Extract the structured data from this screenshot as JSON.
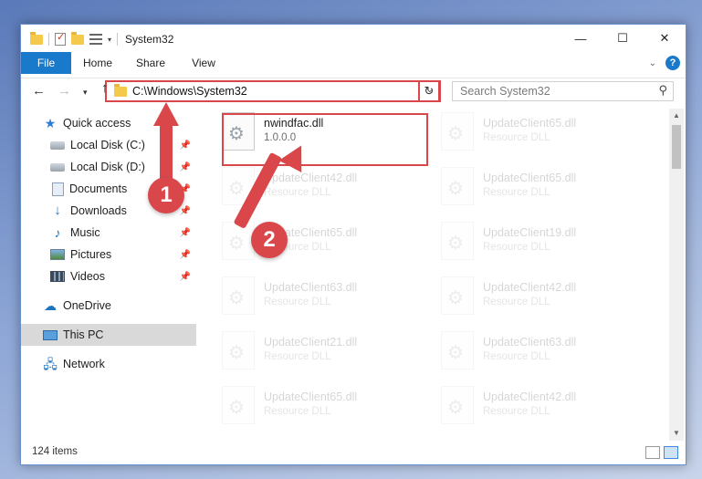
{
  "titlebar": {
    "title": "System32",
    "controls": {
      "minimize": "—",
      "maximize": "☐",
      "close": "✕"
    }
  },
  "ribbon": {
    "tabs": [
      "File",
      "Home",
      "Share",
      "View"
    ],
    "help": "?"
  },
  "address_bar": {
    "path": "C:\\Windows\\System32",
    "refresh_glyph": "↻"
  },
  "search": {
    "placeholder": "Search System32"
  },
  "nav": {
    "quick_access": "Quick access",
    "items": [
      {
        "label": "Local Disk (C:)",
        "icon": "drive-icon",
        "pinned": true
      },
      {
        "label": "Local Disk (D:)",
        "icon": "drive-icon",
        "pinned": true
      },
      {
        "label": "Documents",
        "icon": "documents-icon",
        "pinned": true
      },
      {
        "label": "Downloads",
        "icon": "downloads-icon",
        "pinned": true
      },
      {
        "label": "Music",
        "icon": "music-icon",
        "pinned": true
      },
      {
        "label": "Pictures",
        "icon": "pictures-icon",
        "pinned": true
      },
      {
        "label": "Videos",
        "icon": "videos-icon",
        "pinned": true
      }
    ],
    "onedrive": "OneDrive",
    "this_pc": "This PC",
    "network": "Network"
  },
  "files": [
    {
      "name": "nwindfac.dll",
      "sub": "1.0.0.0",
      "faded": false
    },
    {
      "name": "UpdateClient65.dll",
      "sub": "Resource DLL",
      "faded": true
    },
    {
      "name": "UpdateClient42.dll",
      "sub": "Resource DLL",
      "faded": true
    },
    {
      "name": "UpdateClient65.dll",
      "sub": "Resource DLL",
      "faded": true
    },
    {
      "name": "UpdateClient65.dll",
      "sub": "Resource DLL",
      "faded": true
    },
    {
      "name": "UpdateClient19.dll",
      "sub": "Resource DLL",
      "faded": true
    },
    {
      "name": "UpdateClient63.dll",
      "sub": "Resource DLL",
      "faded": true
    },
    {
      "name": "UpdateClient42.dll",
      "sub": "Resource DLL",
      "faded": true
    },
    {
      "name": "UpdateClient21.dll",
      "sub": "Resource DLL",
      "faded": true
    },
    {
      "name": "UpdateClient63.dll",
      "sub": "Resource DLL",
      "faded": true
    },
    {
      "name": "UpdateClient65.dll",
      "sub": "Resource DLL",
      "faded": true
    },
    {
      "name": "UpdateClient42.dll",
      "sub": "Resource DLL",
      "faded": true
    }
  ],
  "status": {
    "count": "124 items"
  },
  "annotations": {
    "step1": "1",
    "step2": "2",
    "color": "#d9474b"
  },
  "colors": {
    "accent": "#1979ca",
    "highlight": "#d9474b"
  }
}
